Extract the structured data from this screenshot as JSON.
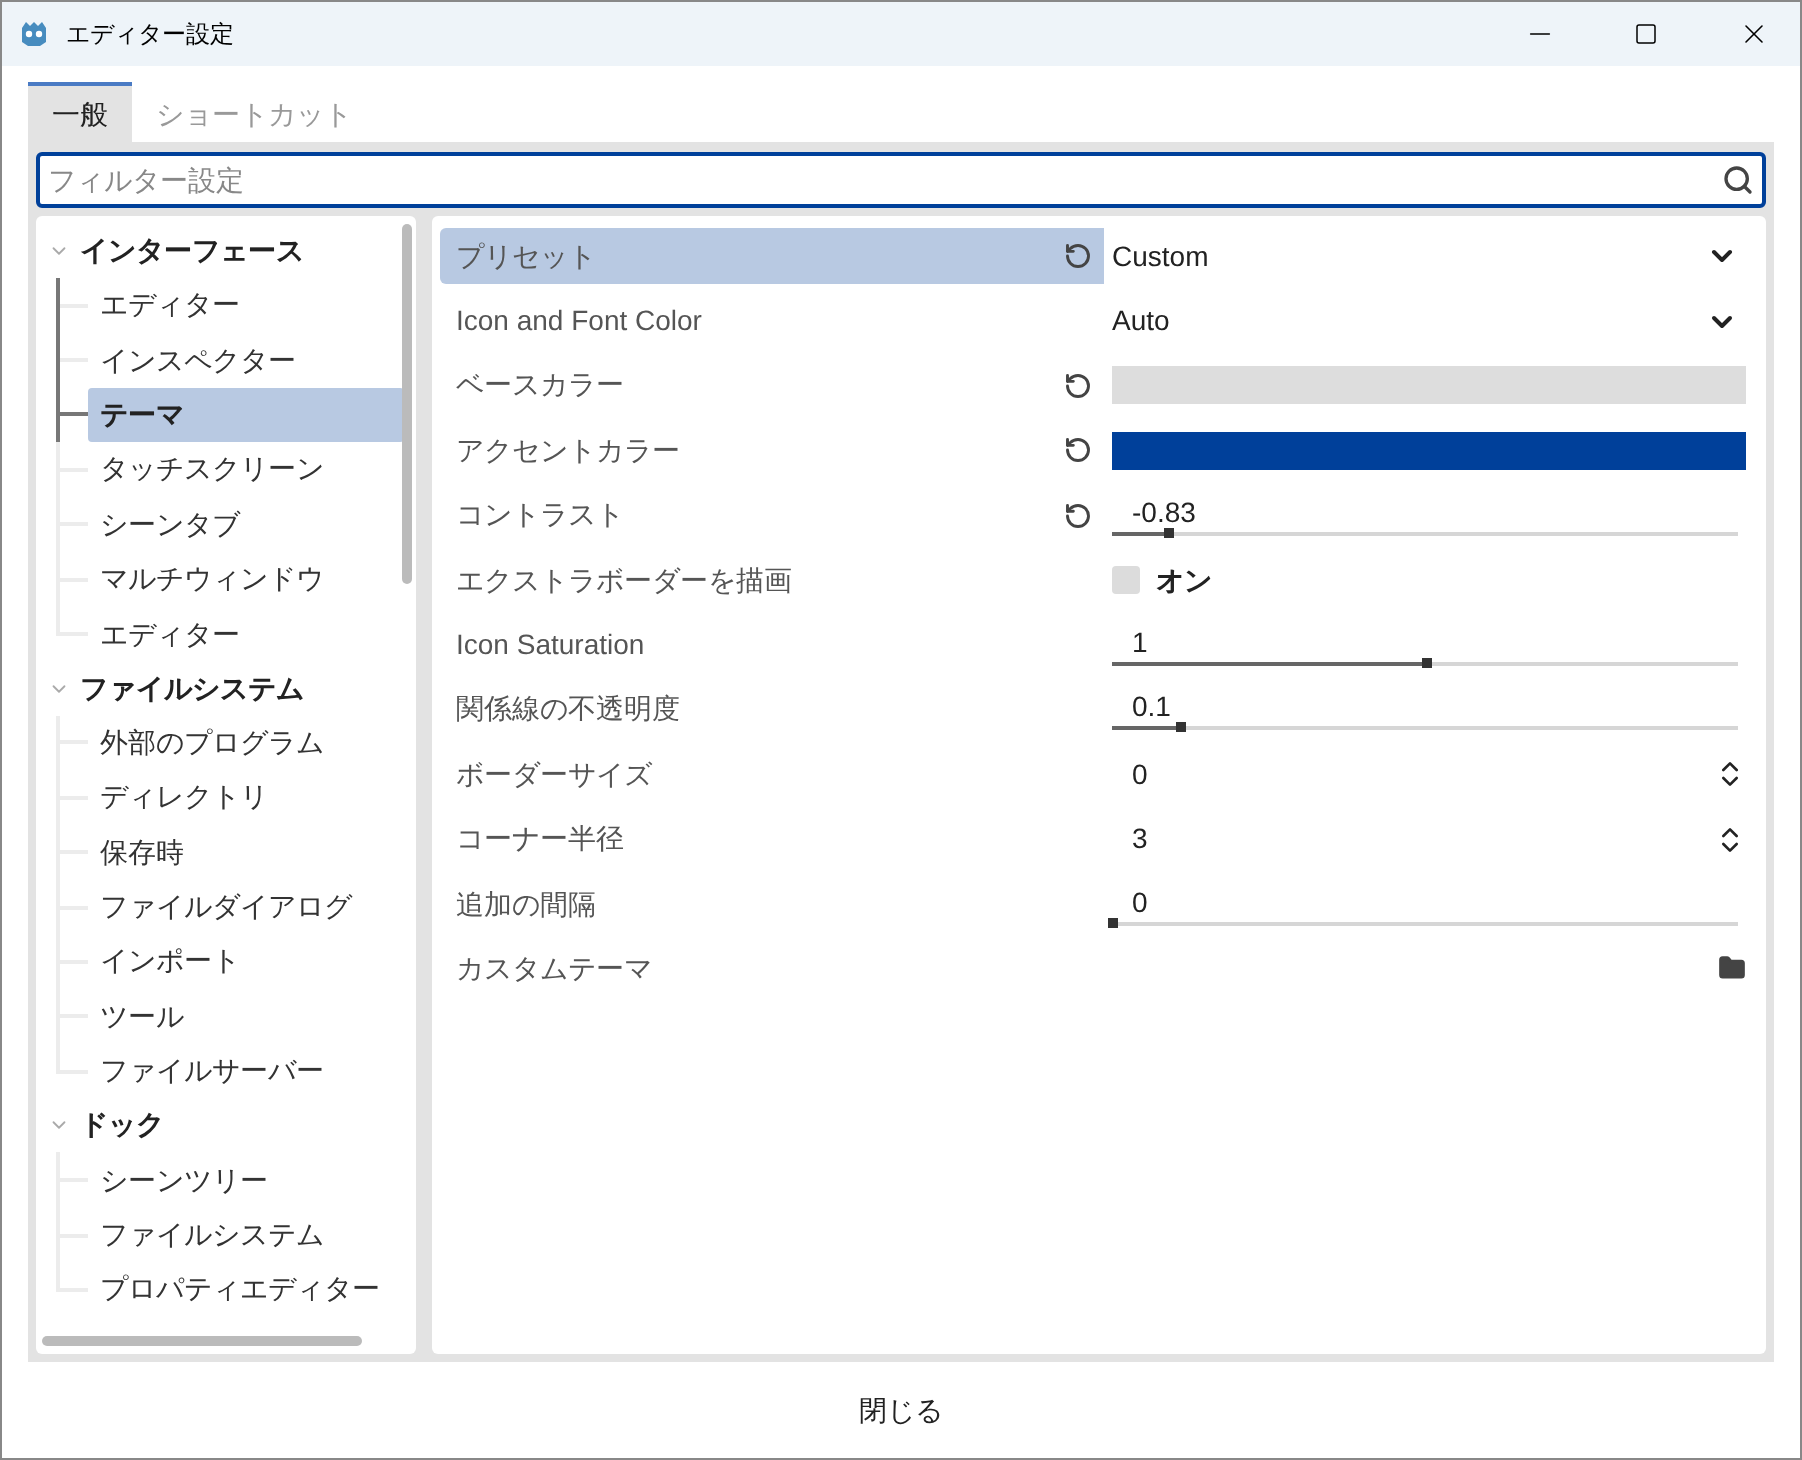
{
  "window": {
    "title": "エディター設定"
  },
  "tabs": [
    {
      "label": "一般",
      "selected": true
    },
    {
      "label": "ショートカット",
      "selected": false
    }
  ],
  "filter": {
    "placeholder": "フィルター設定"
  },
  "tree": [
    {
      "label": "インターフェース",
      "expanded": true,
      "children": [
        {
          "label": "エディター",
          "selected": false
        },
        {
          "label": "インスペクター",
          "selected": false
        },
        {
          "label": "テーマ",
          "selected": true
        },
        {
          "label": "タッチスクリーン",
          "selected": false
        },
        {
          "label": "シーンタブ",
          "selected": false
        },
        {
          "label": "マルチウィンドウ",
          "selected": false
        },
        {
          "label": "エディター",
          "selected": false
        }
      ]
    },
    {
      "label": "ファイルシステム",
      "expanded": true,
      "children": [
        {
          "label": "外部のプログラム",
          "selected": false
        },
        {
          "label": "ディレクトリ",
          "selected": false
        },
        {
          "label": "保存時",
          "selected": false
        },
        {
          "label": "ファイルダイアログ",
          "selected": false
        },
        {
          "label": "インポート",
          "selected": false
        },
        {
          "label": "ツール",
          "selected": false
        },
        {
          "label": "ファイルサーバー",
          "selected": false
        }
      ]
    },
    {
      "label": "ドック",
      "expanded": true,
      "children": [
        {
          "label": "シーンツリー",
          "selected": false
        },
        {
          "label": "ファイルシステム",
          "selected": false
        },
        {
          "label": "プロパティエディター",
          "selected": false
        }
      ]
    }
  ],
  "settings": [
    {
      "label": "プリセット",
      "kind": "dropdown",
      "value": "Custom",
      "reset": true,
      "selected": true
    },
    {
      "label": "Icon and Font Color",
      "kind": "dropdown",
      "value": "Auto",
      "reset": false,
      "selected": false
    },
    {
      "label": "ベースカラー",
      "kind": "color",
      "color": "#dddddd",
      "reset": true,
      "selected": false
    },
    {
      "label": "アクセントカラー",
      "kind": "color",
      "color": "#00409a",
      "reset": true,
      "selected": false
    },
    {
      "label": "コントラスト",
      "kind": "slider",
      "value": "-0.83",
      "level": 0.09,
      "reset": true,
      "selected": false
    },
    {
      "label": "エクストラボーダーを描画",
      "kind": "checkbox",
      "value": "オン",
      "checked": false,
      "reset": false,
      "selected": false
    },
    {
      "label": "Icon Saturation",
      "kind": "slider",
      "value": "1",
      "level": 0.5,
      "reset": false,
      "selected": false
    },
    {
      "label": "関係線の不透明度",
      "kind": "slider",
      "value": "0.1",
      "level": 0.11,
      "reset": false,
      "selected": false
    },
    {
      "label": "ボーダーサイズ",
      "kind": "spin",
      "value": "0",
      "reset": false,
      "selected": false
    },
    {
      "label": "コーナー半径",
      "kind": "spin",
      "value": "3",
      "reset": false,
      "selected": false
    },
    {
      "label": "追加の間隔",
      "kind": "slider",
      "value": "0",
      "level": 0,
      "reset": false,
      "selected": false
    },
    {
      "label": "カスタムテーマ",
      "kind": "file",
      "reset": false,
      "selected": false
    }
  ],
  "close_button": "閉じる"
}
